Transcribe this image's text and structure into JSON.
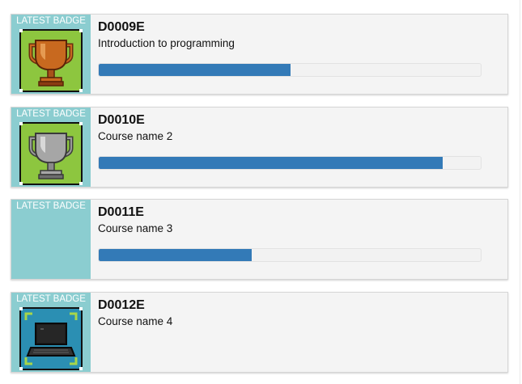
{
  "courses": [
    {
      "badge_label": "LATEST BADGE",
      "badge_icon": "gold-trophy-icon",
      "code": "D0009E",
      "name": "Introduction to programming",
      "progress": 0.502
    },
    {
      "badge_label": "LATEST BADGE",
      "badge_icon": "silver-trophy-icon",
      "code": "D0010E",
      "name": "Course name 2",
      "progress": 0.9
    },
    {
      "badge_label": "LATEST BADGE",
      "badge_icon": "",
      "code": "D0011E",
      "name": "Course name 3",
      "progress": 0.4
    },
    {
      "badge_label": "LATEST BADGE",
      "badge_icon": "laptop-icon",
      "code": "D0012E",
      "name": "Course name 4",
      "progress": null
    }
  ],
  "colors": {
    "badge_panel": "#8bcdd0",
    "progress_fill": "#337ab7",
    "card_bg": "#f4f4f4",
    "tile_green": "#8dc63f",
    "tile_blue": "#2b8fb3"
  }
}
